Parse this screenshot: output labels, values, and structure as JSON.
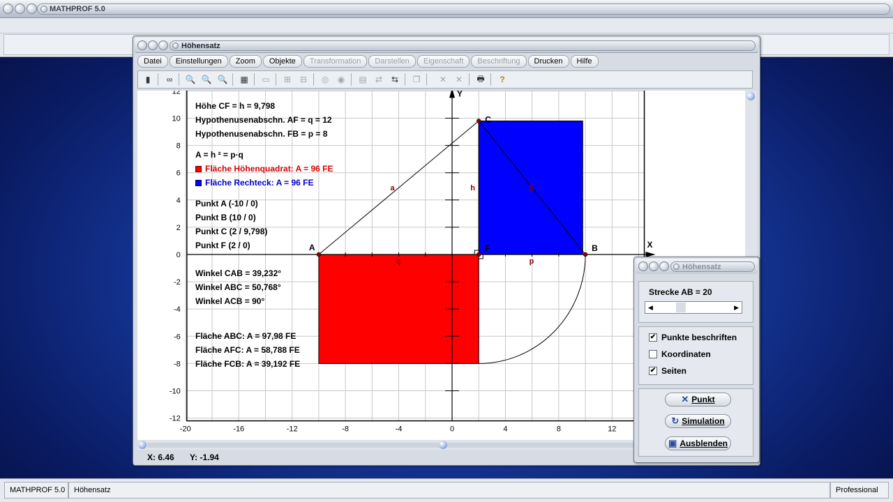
{
  "app": {
    "title": "MATHPROF 5.0",
    "status": {
      "app_name": "MATHPROF 5.0",
      "module": "Höhensatz",
      "edition": "Professional"
    }
  },
  "window": {
    "title": "Höhensatz",
    "menu": [
      {
        "label": "Datei",
        "enabled": true
      },
      {
        "label": "Einstellungen",
        "enabled": true
      },
      {
        "label": "Zoom",
        "enabled": true
      },
      {
        "label": "Objekte",
        "enabled": true
      },
      {
        "label": "Transformation",
        "enabled": false
      },
      {
        "label": "Darstellen",
        "enabled": false
      },
      {
        "label": "Eigenschaft",
        "enabled": false
      },
      {
        "label": "Beschriftung",
        "enabled": false
      },
      {
        "label": "Drucken",
        "enabled": true
      },
      {
        "label": "Hilfe",
        "enabled": true
      }
    ],
    "toolbar_icons": [
      "calculator-icon",
      "glasses-icon",
      "zoom-out-icon",
      "zoom-reset-icon",
      "zoom-in-icon",
      "settings-icon",
      "window-icon",
      "grid-toggle-icon",
      "range-icon",
      "circle-dot-icon",
      "circle-target-icon",
      "table-icon",
      "export-icon",
      "copy-icon",
      "cross-icon",
      "cross-double-icon",
      "print-icon",
      "help-icon"
    ],
    "coords": {
      "x_label": "X: 6.46",
      "y_label": "Y: -1.94"
    }
  },
  "plot": {
    "x_axis_label": "X",
    "y_axis_label": "Y",
    "x_ticks": [
      "-20",
      "-16",
      "-12",
      "-8",
      "-4",
      "0",
      "4",
      "8",
      "12"
    ],
    "y_ticks": [
      "12",
      "10",
      "8",
      "6",
      "4",
      "2",
      "0",
      "-2",
      "-4",
      "-6",
      "-8",
      "-10",
      "-12"
    ],
    "point_labels": {
      "A": "A",
      "B": "B",
      "C": "C",
      "F": "F"
    },
    "side_labels": {
      "a": "a",
      "b": "b",
      "h": "h",
      "q": "q",
      "p": "p"
    },
    "info": {
      "hoehe": "Höhe CF = h = 9,798",
      "hyp_q": "Hypothenusenabschn. AF = q = 12",
      "hyp_p": "Hypothenusenabschn. FB = p = 8",
      "formula": "A = h ² = p·q",
      "legend_red": "Fläche Höhenquadrat: A = 96 FE",
      "legend_blue": "Fläche Rechteck: A = 96 FE",
      "punkt_a": "Punkt A (-10 / 0)",
      "punkt_b": "Punkt B (10 / 0)",
      "punkt_c": "Punkt C (2 / 9,798)",
      "punkt_f": "Punkt F (2 / 0)",
      "winkel_cab": "Winkel CAB = 39,232°",
      "winkel_abc": "Winkel ABC = 50,768°",
      "winkel_acb": "Winkel ACB = 90°",
      "flaeche_abc": "Fläche ABC: A = 97,98 FE",
      "flaeche_afc": "Fläche AFC: A = 58,788 FE",
      "flaeche_fcb": "Fläche FCB: A = 39,192 FE"
    },
    "colors": {
      "red": "#ff0000",
      "blue": "#0000ff",
      "dark_red": "#8b0000",
      "grid": "#c8c8c8"
    }
  },
  "chart_data": {
    "type": "scatter",
    "title": "",
    "xlabel": "X",
    "ylabel": "Y",
    "xlim": [
      -20,
      14
    ],
    "ylim": [
      -12,
      12
    ],
    "grid": true,
    "points": [
      {
        "name": "A",
        "x": -10,
        "y": 0
      },
      {
        "name": "B",
        "x": 10,
        "y": 0
      },
      {
        "name": "C",
        "x": 2,
        "y": 9.798
      },
      {
        "name": "F",
        "x": 2,
        "y": 0
      }
    ],
    "triangle": [
      "A",
      "B",
      "C"
    ],
    "square_red": {
      "x": [
        -10,
        2
      ],
      "y": [
        -8,
        0
      ],
      "area": 96
    },
    "rectangle_blue": {
      "x": [
        2,
        9.798
      ],
      "y": [
        0,
        9.798
      ],
      "area": 96
    },
    "arc": {
      "center_x": 2,
      "center_y": 0,
      "radius": 8,
      "from_deg": 270,
      "to_deg": 360
    }
  },
  "dialog": {
    "title": "Höhensatz",
    "strecke_label": "Strecke AB = 20",
    "slider_value": 20,
    "checkboxes": [
      {
        "label": "Punkte beschriften",
        "checked": true
      },
      {
        "label": "Koordinaten",
        "checked": false
      },
      {
        "label": "Seiten",
        "checked": true
      }
    ],
    "buttons": [
      {
        "label": "Punkt",
        "icon": "point-icon"
      },
      {
        "label": "Simulation",
        "icon": "refresh-icon"
      },
      {
        "label": "Ausblenden",
        "icon": "hide-icon"
      }
    ]
  }
}
